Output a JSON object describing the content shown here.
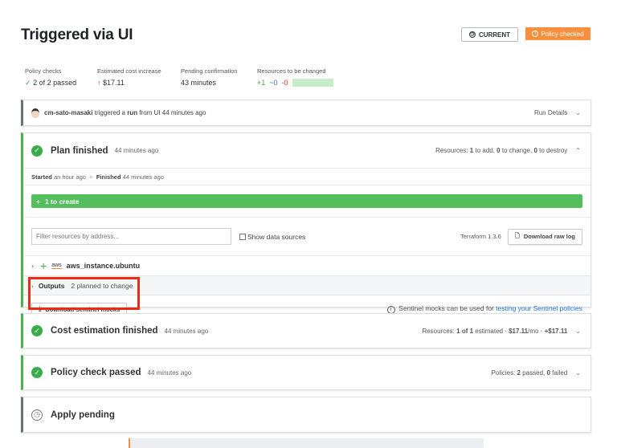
{
  "title": "Triggered via UI",
  "current_label": "CURRENT",
  "status_badge": "Policy checked",
  "stats": [
    {
      "label": "Policy checks",
      "value": "2 of 2 passed"
    },
    {
      "label": "Estimated cost increase",
      "value": "$17.11"
    },
    {
      "label": "Pending confirmation",
      "value": "43 minutes"
    },
    {
      "label": "Resources to be changed",
      "add": "+1",
      "change": "~0",
      "destroy": "-0"
    }
  ],
  "run": {
    "user": "cm-sato-masaki",
    "text1": "triggered a",
    "run": "run",
    "text2": "from UI 44 minutes ago",
    "details": "Run Details"
  },
  "plan": {
    "title": "Plan finished",
    "ago": "44 minutes ago",
    "res_prefix": "Resources:",
    "add": "1",
    "add_t": "to add,",
    "change": "0",
    "change_t": "to change,",
    "destroy": "0",
    "destroy_t": "to destroy",
    "started_l": "Started",
    "started_v": "an hour ago",
    "finished_l": "Finished",
    "finished_v": "44 minutes ago",
    "create_bar": "1 to create",
    "filter_placeholder": "Filter resources by address...",
    "show_data": "Show data sources",
    "tf_version": "Terraform 1.3.6",
    "download_log": "Download raw log",
    "resource": "aws_instance.ubuntu",
    "aws": "aws",
    "outputs_l": "Outputs",
    "outputs_v": "2 planned to change",
    "download_mocks": "Download Sentinel mocks",
    "mocks_info": "Sentinel mocks can be used for",
    "mocks_link": "testing your Sentinel policies"
  },
  "cost": {
    "title": "Cost estimation finished",
    "ago": "44 minutes ago",
    "r1": "Resources:",
    "n1": "1 of 1",
    "r2": "estimated ·",
    "mo": "$17.11",
    "r3": "/mo ·",
    "delta": "+$17.11"
  },
  "policy": {
    "title": "Policy check passed",
    "ago": "44 minutes ago",
    "r1": "Policies:",
    "p": "2",
    "r2": "passed,",
    "f": "0",
    "r3": "failed"
  },
  "apply": {
    "title": "Apply pending"
  },
  "colors": {
    "green": "#3aac4a",
    "orange": "#f6903e",
    "blue": "#2778d6",
    "red": "#e0302a"
  }
}
